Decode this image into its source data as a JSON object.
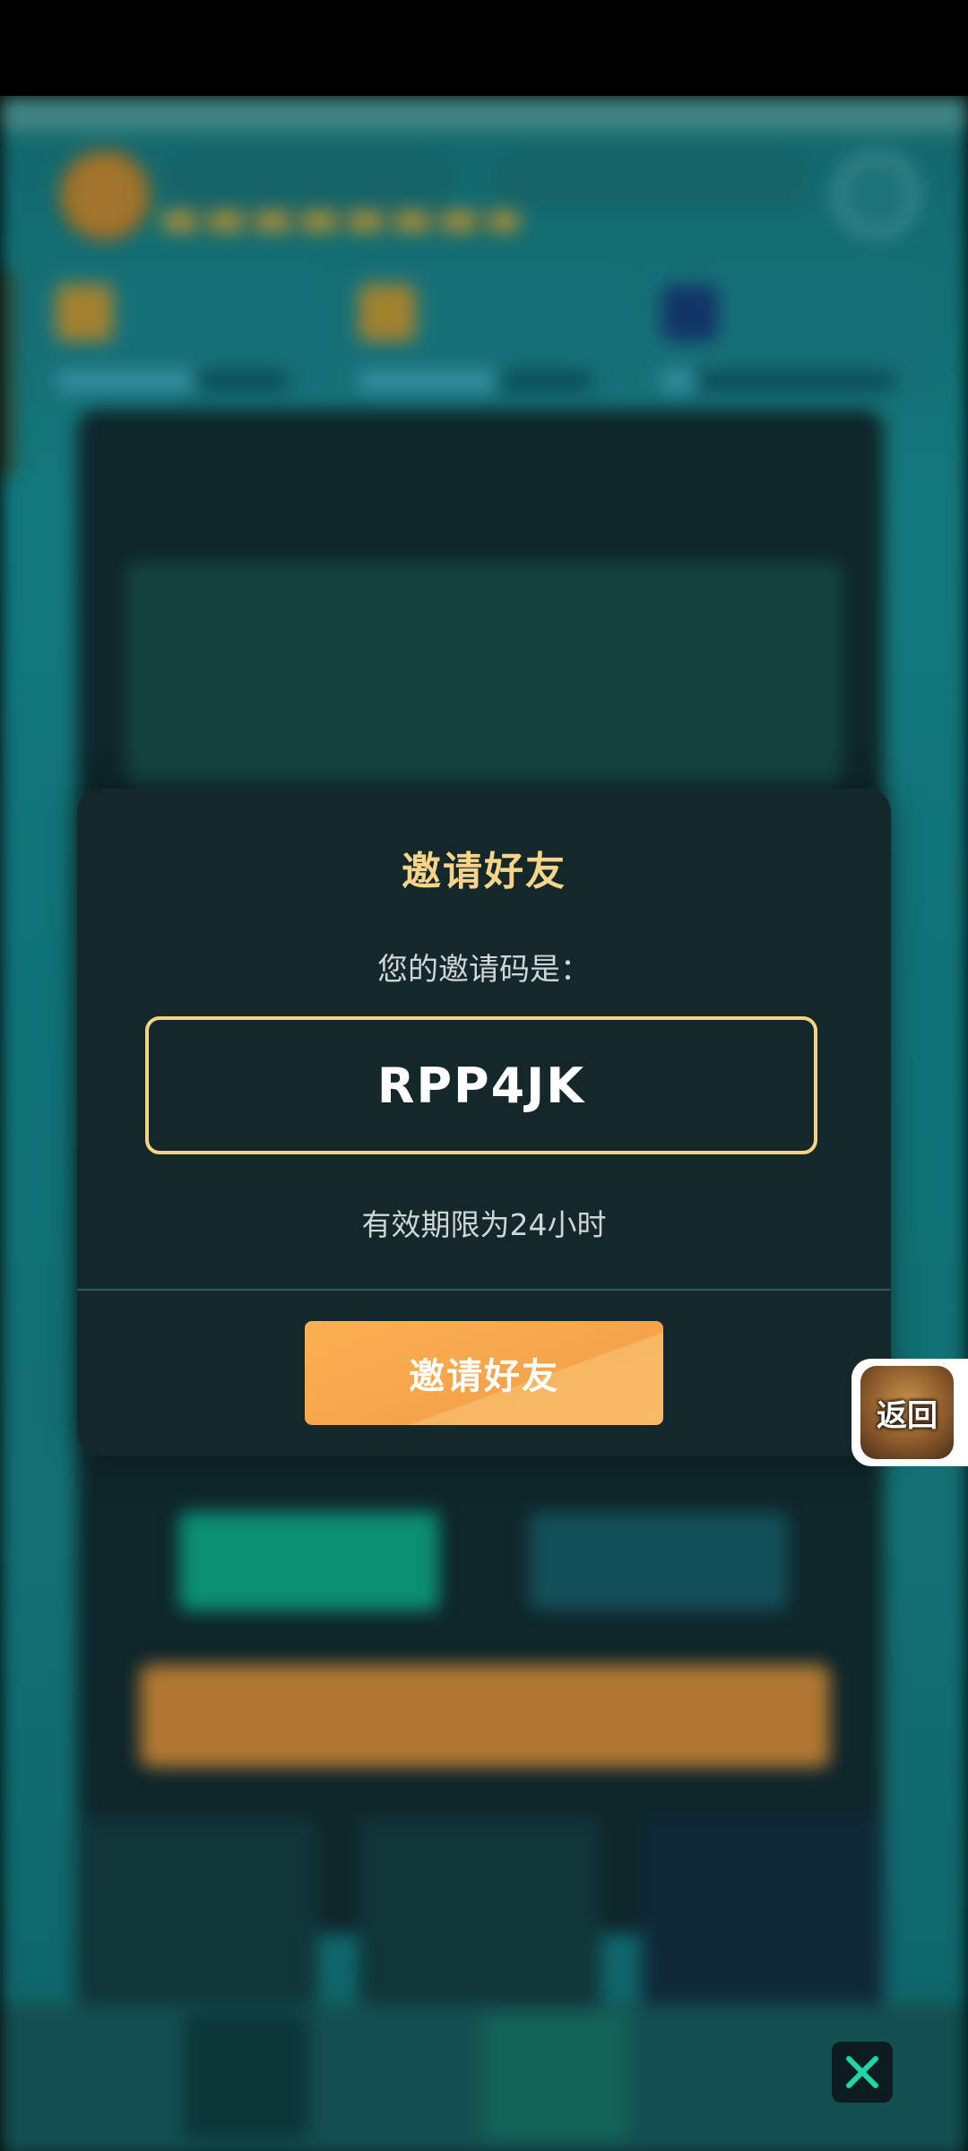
{
  "dialog": {
    "title": "邀请好友",
    "subtitle": "您的邀请码是：",
    "invite_code": "RPP4JK",
    "validity": "有效期限为24小时",
    "invite_button_label": "邀请好友"
  },
  "floating": {
    "return_label": "返回"
  },
  "icons": {
    "close": "close-icon"
  },
  "colors": {
    "accent_gold": "#f6d58a",
    "button_orange": "#f6a34a",
    "dialog_bg": "#14282c",
    "close_icon": "#21d4a8"
  }
}
